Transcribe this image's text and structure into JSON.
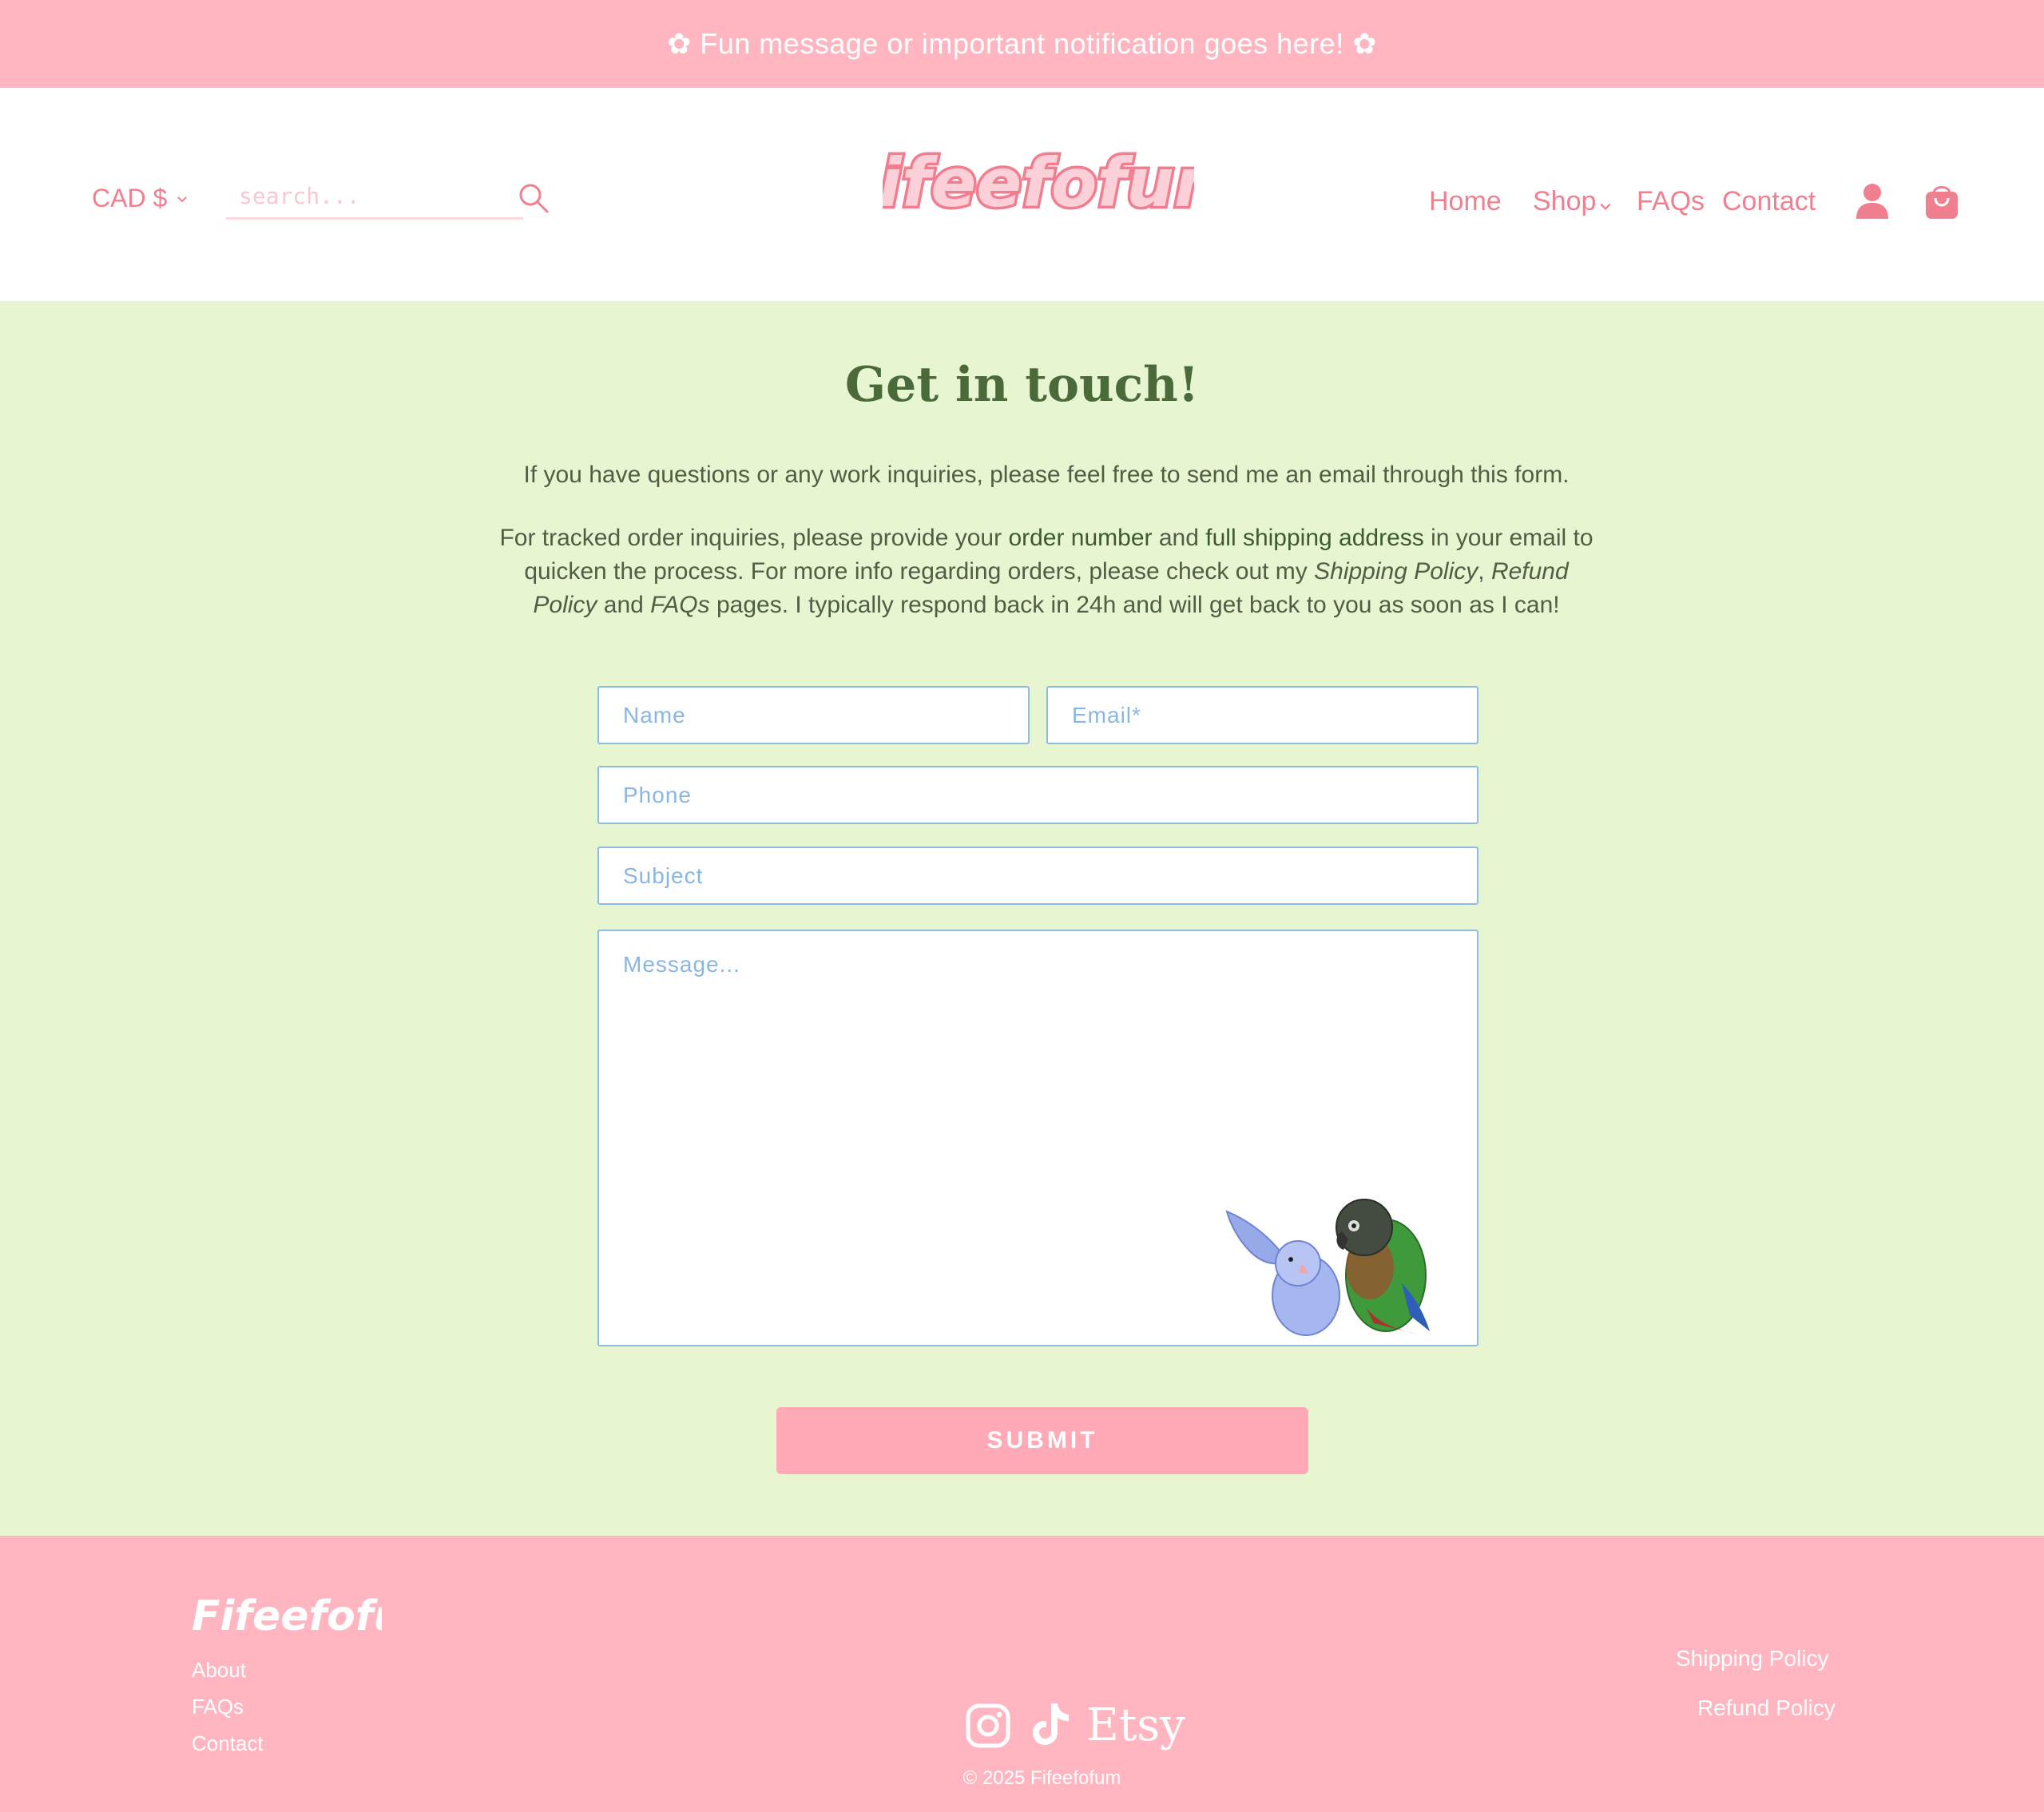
{
  "announcement": "✿ Fun message or important notification goes here! ✿",
  "header": {
    "currency": "CAD $",
    "search_placeholder": "search...",
    "logo_text": "Fifeefofum",
    "nav": {
      "home": "Home",
      "shop": "Shop",
      "faqs": "FAQs",
      "contact": "Contact"
    }
  },
  "main": {
    "title": "Get in touch!",
    "intro": "If you have questions or any work inquiries, please feel free to send me an email through this form.",
    "details": {
      "t1": "For tracked order inquiries, please provide your ",
      "b1": "order number",
      "t2": " and ",
      "b2": "full shipping address",
      "t3": " in your email to quicken the process.  For more info regarding orders, please check out my ",
      "i1": "Shipping Policy",
      "t4": ", ",
      "i2": "Refund Policy",
      "t5": " and ",
      "i3": "FAQs",
      "t6": " pages. I typically respond back in 24h and will get back to you as soon as I can!"
    },
    "form": {
      "name_placeholder": "Name",
      "email_placeholder": "Email*",
      "phone_placeholder": "Phone",
      "subject_placeholder": "Subject",
      "message_placeholder": "Message...",
      "submit_label": "SUBMIT"
    }
  },
  "footer": {
    "logo_text": "Fifeefofum",
    "left_links": [
      "About",
      "FAQs",
      "Contact"
    ],
    "right_links": [
      "Shipping Policy",
      "Refund Policy"
    ],
    "etsy_label": "Etsy",
    "copyright": "© 2025 Fifeefofum"
  },
  "colors": {
    "announcement_bg": "#ffb6c1",
    "accent_pink": "#f07f8f",
    "main_bg": "#e7f5d1",
    "title_green": "#4a6a3a",
    "field_border": "#8cbde0",
    "submit_bg": "#ffaab6"
  }
}
